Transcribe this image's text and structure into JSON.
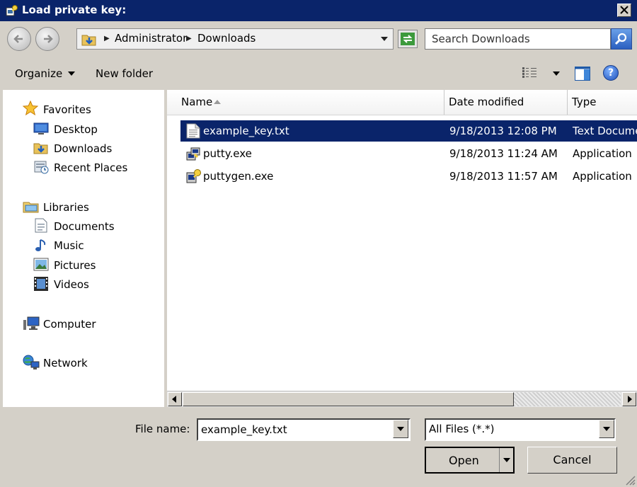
{
  "window": {
    "title": "Load private key:"
  },
  "address": {
    "crumbs": [
      "Administrator",
      "Downloads"
    ],
    "search_placeholder": "Search Downloads"
  },
  "toolbar": {
    "organize_label": "Organize",
    "new_folder_label": "New folder"
  },
  "sidebar": {
    "favorites": {
      "label": "Favorites",
      "items": [
        "Desktop",
        "Downloads",
        "Recent Places"
      ]
    },
    "libraries": {
      "label": "Libraries",
      "items": [
        "Documents",
        "Music",
        "Pictures",
        "Videos"
      ]
    },
    "computer_label": "Computer",
    "network_label": "Network"
  },
  "file_list": {
    "columns": [
      "Name",
      "Date modified",
      "Type"
    ],
    "rows": [
      {
        "name": "example_key.txt",
        "date": "9/18/2013 12:08 PM",
        "type": "Text Document",
        "icon": "text-file-icon",
        "selected": true
      },
      {
        "name": "putty.exe",
        "date": "9/18/2013 11:24 AM",
        "type": "Application",
        "icon": "putty-app-icon",
        "selected": false
      },
      {
        "name": "puttygen.exe",
        "date": "9/18/2013 11:57 AM",
        "type": "Application",
        "icon": "puttygen-app-icon",
        "selected": false
      }
    ]
  },
  "footer": {
    "file_name_label": "File name:",
    "file_name_value": "example_key.txt",
    "file_type_value": "All Files (*.*)",
    "open_label": "Open",
    "cancel_label": "Cancel"
  },
  "colors": {
    "title_bar": "#0a246a",
    "selection": "#0a246a",
    "face": "#d4d0c8"
  }
}
